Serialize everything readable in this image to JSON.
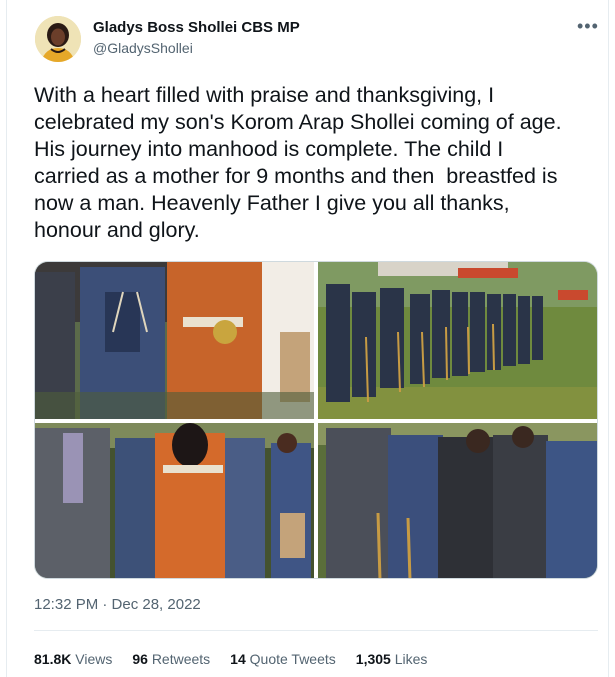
{
  "author": {
    "name": "Gladys Boss Shollei CBS MP",
    "handle": "@GladysShollei",
    "more_icon": "more-horizontal-icon"
  },
  "tweet": {
    "text": "With a heart filled with praise and thanksgiving, I\ncelebrated my son's Korom Arap Shollei coming of age.\nHis journey into manhood is complete. The child I\ncarried as a mother for 9 months and then  breastfed is\nnow a man. Heavenly Father I give you all thanks,\nhonour and glory."
  },
  "media": {
    "photo_count": 4
  },
  "meta": {
    "timestamp": "12:32 PM · Dec 28, 2022"
  },
  "stats": {
    "views_value": "81.8K",
    "views_label": "Views",
    "retweets_value": "96",
    "retweets_label": "Retweets",
    "quotes_value": "14",
    "quotes_label": "Quote Tweets",
    "likes_value": "1,305",
    "likes_label": "Likes"
  },
  "colors": {
    "text_primary": "#0f1419",
    "text_secondary": "#536471",
    "border": "#e6ecf0"
  }
}
